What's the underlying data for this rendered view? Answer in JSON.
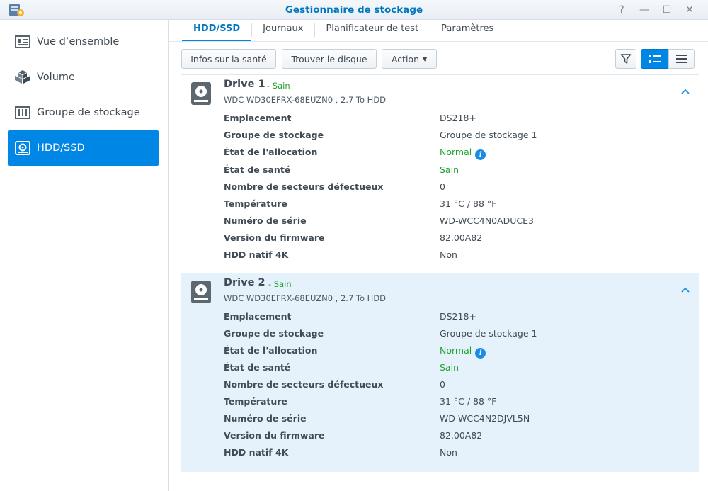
{
  "window": {
    "title": "Gestionnaire de stockage",
    "help_glyph": "?",
    "minimize_glyph": "—",
    "maximize_glyph": "☐",
    "close_glyph": "✕"
  },
  "sidebar": {
    "items": [
      {
        "label": "Vue d’ensemble",
        "icon": "overview-icon",
        "active": false
      },
      {
        "label": "Volume",
        "icon": "volume-icon",
        "active": false
      },
      {
        "label": "Groupe de stockage",
        "icon": "storage-pool-icon",
        "active": false
      },
      {
        "label": "HDD/SSD",
        "icon": "hdd-icon",
        "active": true
      }
    ]
  },
  "tabs": [
    {
      "label": "HDD/SSD",
      "active": true
    },
    {
      "label": "Journaux",
      "active": false
    },
    {
      "label": "Planificateur de test",
      "active": false
    },
    {
      "label": "Paramètres",
      "active": false
    }
  ],
  "toolbar": {
    "health_info": "Infos sur la santé",
    "locate_disk": "Trouver le disque",
    "action": "Action"
  },
  "drives": [
    {
      "name": "Drive 1",
      "status": "- Sain",
      "model": "WDC WD30EFRX-68EUZN0 , 2.7 To HDD",
      "rows": [
        {
          "label": "Emplacement",
          "value": "DS218+"
        },
        {
          "label": "Groupe de stockage",
          "value": "Groupe de stockage 1"
        },
        {
          "label": "État de l'allocation",
          "value": "Normal"
        },
        {
          "label": "État de santé",
          "value": "Sain"
        },
        {
          "label": "Nombre de secteurs défectueux",
          "value": "0"
        },
        {
          "label": "Température",
          "value": "31 °C / 88 °F"
        },
        {
          "label": "Numéro de série",
          "value": "WD-WCC4N0ADUCE3"
        },
        {
          "label": "Version du firmware",
          "value": "82.00A82"
        },
        {
          "label": "HDD natif 4K",
          "value": "Non"
        }
      ]
    },
    {
      "name": "Drive 2",
      "status": "- Sain",
      "model": "WDC WD30EFRX-68EUZN0 , 2.7 To HDD",
      "rows": [
        {
          "label": "Emplacement",
          "value": "DS218+"
        },
        {
          "label": "Groupe de stockage",
          "value": "Groupe de stockage 1"
        },
        {
          "label": "État de l'allocation",
          "value": "Normal"
        },
        {
          "label": "État de santé",
          "value": "Sain"
        },
        {
          "label": "Nombre de secteurs défectueux",
          "value": "0"
        },
        {
          "label": "Température",
          "value": "31 °C / 88 °F"
        },
        {
          "label": "Numéro de série",
          "value": "WD-WCC4N2DJVL5N"
        },
        {
          "label": "Version du firmware",
          "value": "82.00A82"
        },
        {
          "label": "HDD natif 4K",
          "value": "Non"
        }
      ]
    }
  ],
  "info_glyph": "i",
  "colors": {
    "accent": "#0086e5",
    "status_green": "#1fa22e",
    "selected_row": "#e5f2fb"
  }
}
